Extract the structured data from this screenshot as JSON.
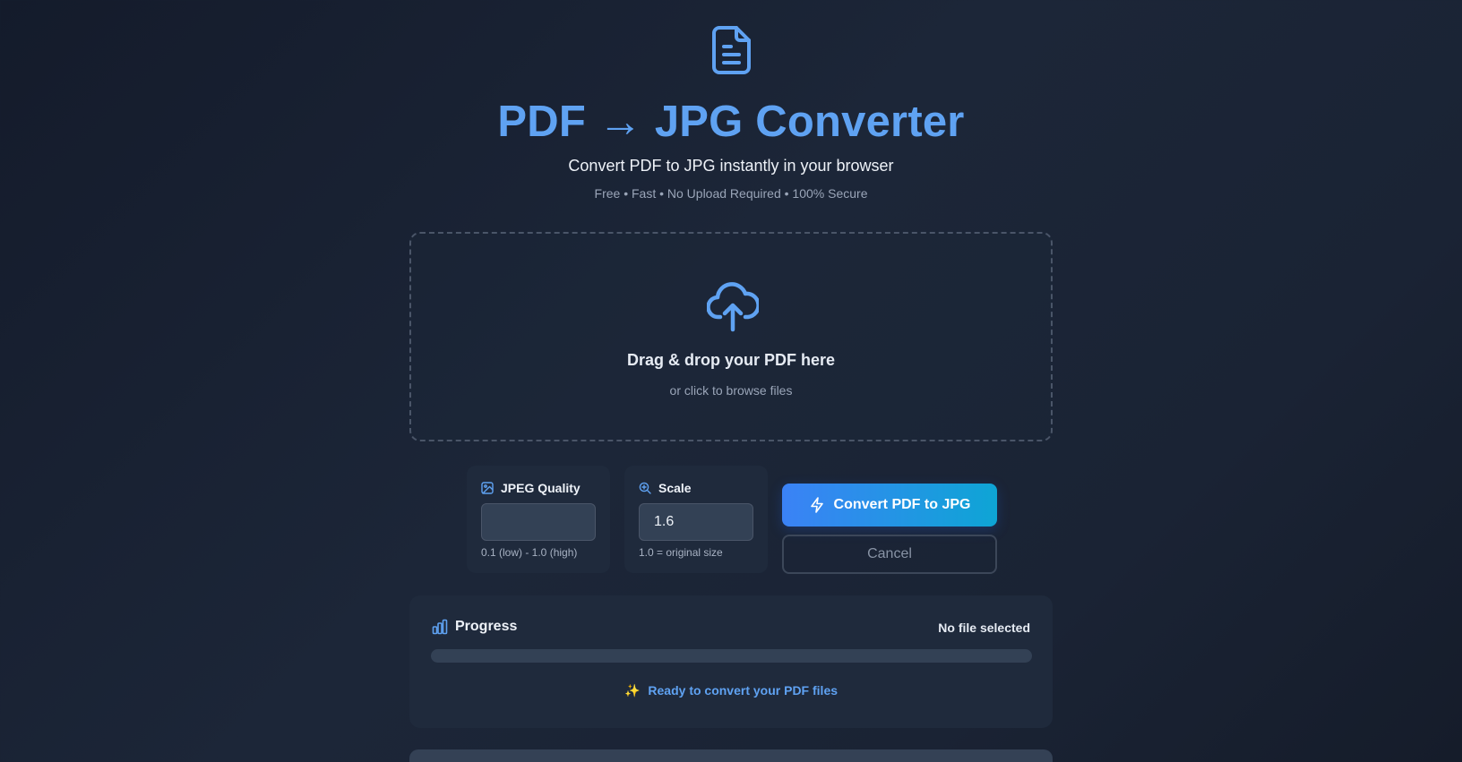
{
  "header": {
    "icon": "document-icon",
    "title": "PDF → JPG Converter",
    "subtitle": "Convert PDF to JPG instantly in your browser",
    "tagline": "Free • Fast • No Upload Required • 100% Secure"
  },
  "dropzone": {
    "icon": "cloud-upload-icon",
    "title": "Drag & drop your PDF here",
    "subtitle": "or click to browse files"
  },
  "settings": {
    "quality": {
      "icon": "image-icon",
      "label": "JPEG Quality",
      "value": "",
      "hint": "0.1 (low) - 1.0 (high)"
    },
    "scale": {
      "icon": "zoom-in-icon",
      "label": "Scale",
      "value": "1.6",
      "hint": "1.0 = original size"
    }
  },
  "actions": {
    "convert_icon": "lightning-icon",
    "convert_label": "Convert PDF to JPG",
    "cancel_label": "Cancel"
  },
  "progress": {
    "icon": "bar-chart-icon",
    "title": "Progress",
    "status": "No file selected",
    "percent": 0,
    "message_icon": "sparkles-icon",
    "message": "Ready to convert your PDF files"
  },
  "colors": {
    "accent": "#5fa2f2",
    "button_start": "#3b82f6",
    "button_end": "#0ea5d5",
    "sparkle": "#f5b941"
  }
}
